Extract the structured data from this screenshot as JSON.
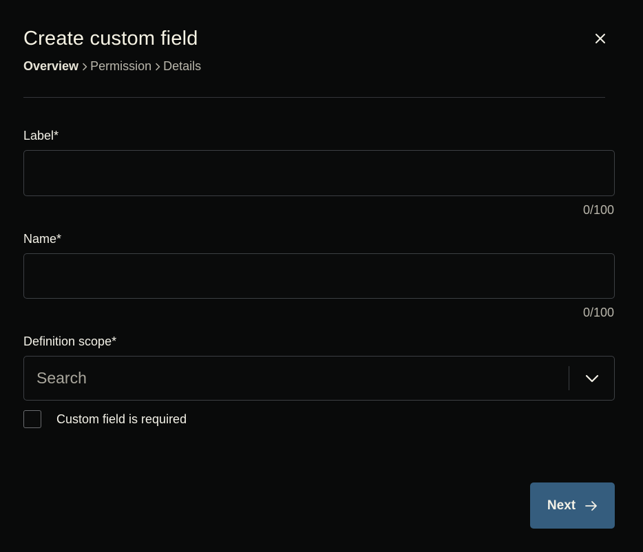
{
  "dialog": {
    "title": "Create custom field",
    "close_icon": "close-icon"
  },
  "breadcrumb": {
    "items": [
      {
        "label": "Overview",
        "active": true
      },
      {
        "label": "Permission",
        "active": false
      },
      {
        "label": "Details",
        "active": false
      }
    ],
    "separator_icon": "chevron-right-icon"
  },
  "form": {
    "label_field": {
      "label": "Label*",
      "value": "",
      "counter": "0/100"
    },
    "name_field": {
      "label": "Name*",
      "value": "",
      "counter": "0/100"
    },
    "scope_field": {
      "label": "Definition scope*",
      "placeholder": "Search",
      "toggle_icon": "chevron-down-icon"
    },
    "required_checkbox": {
      "label": "Custom field is required",
      "checked": false
    }
  },
  "footer": {
    "next_label": "Next",
    "next_icon": "arrow-right-icon"
  },
  "colors": {
    "background": "#090a0a",
    "primary_button": "#355d7e",
    "text": "#f3f1e7",
    "muted_text": "#b9b6ab",
    "border": "#3d4044"
  }
}
